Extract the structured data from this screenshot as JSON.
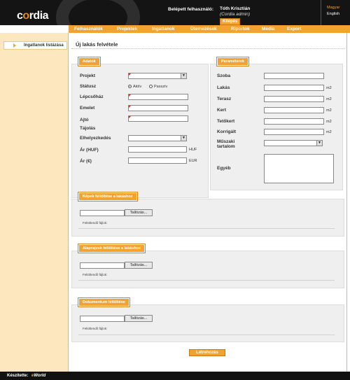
{
  "header": {
    "logo_prefix": "c",
    "logo_o": "o",
    "logo_suffix": "rdia",
    "logged_in_label": "Belépett felhasználó:",
    "user_name": "Tóth Krisztián",
    "user_role": "(Cordia admin)",
    "logout_label": "Kilépés",
    "lang_hu": "Magyar",
    "lang_en": "English"
  },
  "nav": [
    "Felhasználók",
    "Projektek",
    "Ingatlanok",
    "Ütemezések",
    "Riportok",
    "Média",
    "Export"
  ],
  "sidebar": {
    "item_label": "Ingatlanok listázása"
  },
  "page": {
    "title": "Új lakás felvétele"
  },
  "adatok": {
    "tab": "Adatok",
    "project_label": "Projekt",
    "status_label": "Státusz",
    "status_active": "Aktív",
    "status_passive": "Passzív",
    "staircase_label": "Lépcsőház",
    "floor_label": "Emelet",
    "door_label": "Ajtó",
    "orientation_label": "Tájolás",
    "position_label": "Elhelyezkedés",
    "price_huf_label": "Ár (HUF)",
    "price_huf_unit": "HUF",
    "price_eur_label": "Ár (€)",
    "price_eur_unit": "EUR"
  },
  "parameterek": {
    "tab": "Paraméterek",
    "room_label": "Szoba",
    "flat_label": "Lakás",
    "terrace_label": "Terasz",
    "garden_label": "Kert",
    "roofgarden_label": "Tetőkert",
    "corrected_label": "Korrigált",
    "unit_m2": "m2",
    "tech_label_1": "Műszaki",
    "tech_label_2": "tartalom",
    "other_label": "Egyéb"
  },
  "uploads": {
    "images_tab": "Képek feltöltése a lakáshoz",
    "plans_tab": "Alaprajzok feltöltése a lakáshoz",
    "docs_tab": "Dokumentum feltöltése",
    "browse_label": "Tallózás...",
    "files_label": "Feltöltendő fájlok:"
  },
  "submit_label": "Létrehozás",
  "footer": {
    "made_by": "Készítette:",
    "brand_e": "e",
    "brand_rest": "World"
  },
  "colors": {
    "accent": "#f2a22f",
    "header_bg": "#141414",
    "sidebar_bg": "#fce7bf",
    "panel_bg": "#efefef",
    "required_marker": "#e02020"
  }
}
